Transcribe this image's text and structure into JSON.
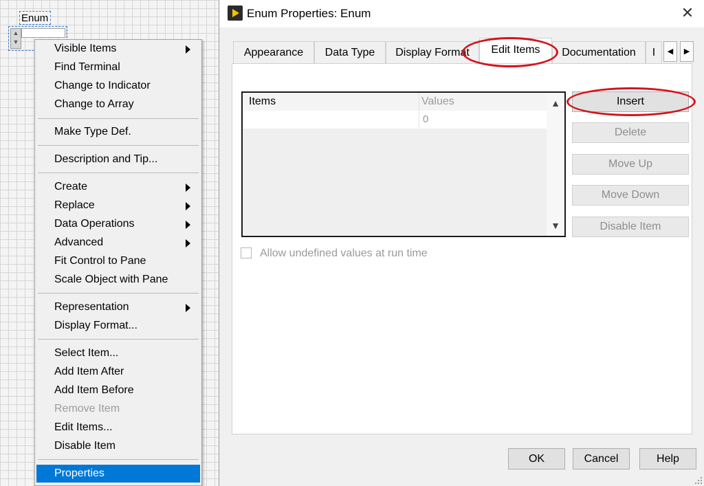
{
  "front_panel": {
    "enum_label": "Enum"
  },
  "context_menu": {
    "items": [
      {
        "label": "Visible Items",
        "submenu": true,
        "disabled": false
      },
      {
        "label": "Find Terminal",
        "submenu": false,
        "disabled": false
      },
      {
        "label": "Change to Indicator",
        "submenu": false,
        "disabled": false
      },
      {
        "label": "Change to Array",
        "submenu": false,
        "disabled": false
      },
      {
        "label": "Make Type Def.",
        "submenu": false,
        "disabled": false
      },
      {
        "label": "Description and Tip...",
        "submenu": false,
        "disabled": false
      },
      {
        "label": "Create",
        "submenu": true,
        "disabled": false
      },
      {
        "label": "Replace",
        "submenu": true,
        "disabled": false
      },
      {
        "label": "Data Operations",
        "submenu": true,
        "disabled": false
      },
      {
        "label": "Advanced",
        "submenu": true,
        "disabled": false
      },
      {
        "label": "Fit Control to Pane",
        "submenu": false,
        "disabled": false
      },
      {
        "label": "Scale Object with Pane",
        "submenu": false,
        "disabled": false
      },
      {
        "label": "Representation",
        "submenu": true,
        "disabled": false
      },
      {
        "label": "Display Format...",
        "submenu": false,
        "disabled": false
      },
      {
        "label": "Select Item...",
        "submenu": false,
        "disabled": false
      },
      {
        "label": "Add Item After",
        "submenu": false,
        "disabled": false
      },
      {
        "label": "Add Item Before",
        "submenu": false,
        "disabled": false
      },
      {
        "label": "Remove Item",
        "submenu": false,
        "disabled": true
      },
      {
        "label": "Edit Items...",
        "submenu": false,
        "disabled": false
      },
      {
        "label": "Disable Item",
        "submenu": false,
        "disabled": false
      },
      {
        "label": "Properties",
        "submenu": false,
        "disabled": false,
        "selected": true
      }
    ]
  },
  "dialog": {
    "title": "Enum Properties: Enum",
    "tabs": [
      {
        "label": "Appearance",
        "active": false
      },
      {
        "label": "Data Type",
        "active": false
      },
      {
        "label": "Display Format",
        "active": false
      },
      {
        "label": "Edit Items",
        "active": true
      },
      {
        "label": "Documentation",
        "active": false
      },
      {
        "label": "I",
        "active": false
      }
    ],
    "table": {
      "columns": [
        "Items",
        "Values"
      ],
      "rows": [
        {
          "item": "",
          "value": "0"
        }
      ]
    },
    "side_buttons": {
      "insert": "Insert",
      "delete": "Delete",
      "move_up": "Move Up",
      "move_down": "Move Down",
      "disable_item": "Disable Item"
    },
    "checkbox": {
      "label": "Allow undefined values at run time",
      "checked": false,
      "disabled": true
    },
    "buttons": {
      "ok": "OK",
      "cancel": "Cancel",
      "help": "Help"
    }
  },
  "colors": {
    "selection": "#0078d7",
    "annotation": "#d4141c",
    "labview_icon": "#f5c400"
  }
}
